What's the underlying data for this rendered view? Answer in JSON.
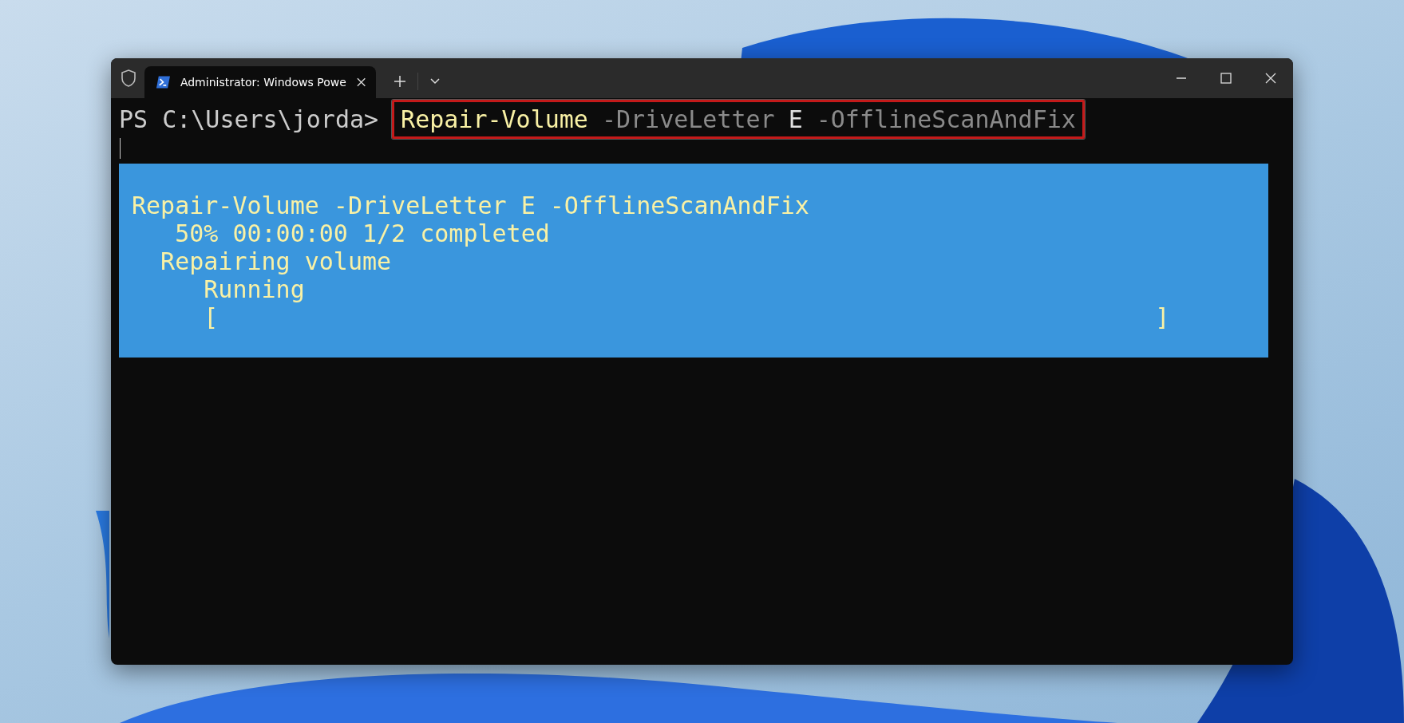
{
  "window": {
    "tabs": [
      {
        "title": "Administrator: Windows Powe",
        "selected": true
      }
    ]
  },
  "terminal": {
    "prompt": "PS C:\\Users\\jorda>",
    "command": {
      "highlighted": true,
      "tokens": [
        {
          "text": "Repair-Volume",
          "kind": "cmdlet"
        },
        {
          "text": "-DriveLetter",
          "kind": "parameter"
        },
        {
          "text": "E",
          "kind": "argument"
        },
        {
          "text": "-OfflineScanAndFix",
          "kind": "parameter"
        }
      ]
    },
    "progress": {
      "title": "Repair-Volume -DriveLetter E -OfflineScanAndFix",
      "status": "50% 00:00:00 1/2 completed",
      "activity": "Repairing volume",
      "operation": "Running",
      "bar_open": "[",
      "bar_close": "]"
    }
  }
}
